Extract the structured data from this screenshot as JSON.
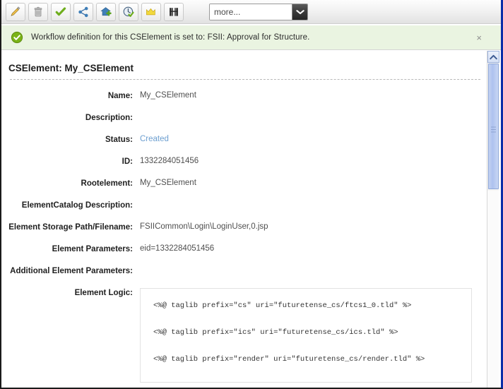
{
  "toolbar": {
    "buttons": [
      {
        "name": "edit-icon",
        "title": "Edit"
      },
      {
        "name": "delete-icon",
        "title": "Delete"
      },
      {
        "name": "approve-icon",
        "title": "Approve"
      },
      {
        "name": "share-icon",
        "title": "Share"
      },
      {
        "name": "add-to-site-icon",
        "title": "Add to site"
      },
      {
        "name": "schedule-publish-icon",
        "title": "Schedule publish"
      },
      {
        "name": "promote-icon",
        "title": "Promote"
      },
      {
        "name": "preview-icon",
        "title": "Preview"
      }
    ],
    "more_dropdown": {
      "value": "more...",
      "options": [
        "more..."
      ]
    }
  },
  "notification": {
    "icon": "success-check-icon",
    "message": "Workflow definition for this CSElement is set to: FSII: Approval for Structure.",
    "close_label": "×",
    "background": "#eaf4e1",
    "icon_color": "#7ab317"
  },
  "page": {
    "title": "CSElement: My_CSElement",
    "fields": [
      {
        "label": "Name:",
        "value": "My_CSElement",
        "is_link": false
      },
      {
        "label": "Description:",
        "value": "",
        "is_link": false
      },
      {
        "label": "Status:",
        "value": "Created",
        "is_link": true
      },
      {
        "label": "ID:",
        "value": "1332284051456",
        "is_link": false
      },
      {
        "label": "Rootelement:",
        "value": "My_CSElement",
        "is_link": false
      },
      {
        "label": "ElementCatalog Description:",
        "value": "",
        "is_link": false
      },
      {
        "label": "Element Storage Path/Filename:",
        "value": "FSIICommon\\Login\\LoginUser,0.jsp",
        "is_link": false
      },
      {
        "label": "Element Parameters:",
        "value": "eid=1332284051456",
        "is_link": false
      },
      {
        "label": "Additional Element Parameters:",
        "value": "",
        "is_link": false
      }
    ],
    "element_logic": {
      "label": "Element Logic:",
      "lines": [
        "<%@ taglib prefix=\"cs\" uri=\"futuretense_cs/ftcs1_0.tld\" %>",
        "<%@ taglib prefix=\"ics\" uri=\"futuretense_cs/ics.tld\" %>",
        "<%@ taglib prefix=\"render\" uri=\"futuretense_cs/render.tld\" %>"
      ]
    }
  },
  "scrollbar": {
    "up_arrow": "scroll-up-icon",
    "thumb": "scroll-thumb"
  },
  "colors": {
    "link": "#6d9fd0",
    "notification_bg": "#eaf4e1",
    "accent_border": "#0b2ea8"
  }
}
